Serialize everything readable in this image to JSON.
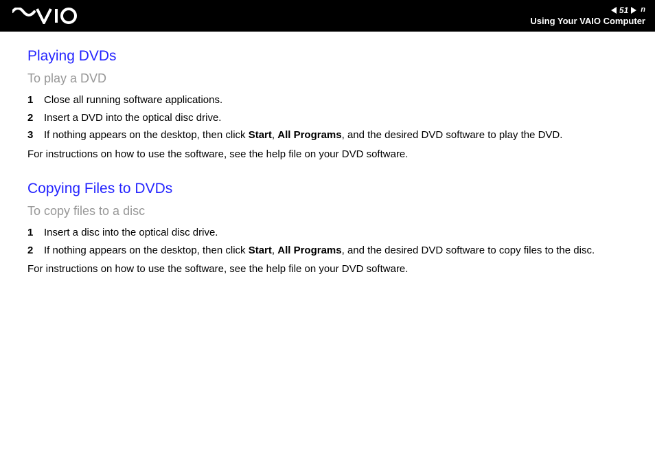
{
  "header": {
    "page_number": "51",
    "n_label": "n",
    "subtitle": "Using Your VAIO Computer"
  },
  "section1": {
    "title": "Playing DVDs",
    "subtitle": "To play a DVD",
    "steps": [
      {
        "num": "1",
        "text": "Close all running software applications."
      },
      {
        "num": "2",
        "text": "Insert a DVD into the optical disc drive."
      },
      {
        "num": "3",
        "prefix": "If nothing appears on the desktop, then click ",
        "bold1": "Start",
        "mid": ", ",
        "bold2": "All Programs",
        "suffix": ", and the desired DVD software to play the DVD."
      }
    ],
    "note": "For instructions on how to use the software, see the help file on your DVD software."
  },
  "section2": {
    "title": "Copying Files to DVDs",
    "subtitle": "To copy files to a disc",
    "steps": [
      {
        "num": "1",
        "text": "Insert a disc into the optical disc drive."
      },
      {
        "num": "2",
        "prefix": "If nothing appears on the desktop, then click ",
        "bold1": "Start",
        "mid": ", ",
        "bold2": "All Programs",
        "suffix": ", and the desired DVD software to copy files to the disc."
      }
    ],
    "note": "For instructions on how to use the software, see the help file on your DVD software."
  }
}
